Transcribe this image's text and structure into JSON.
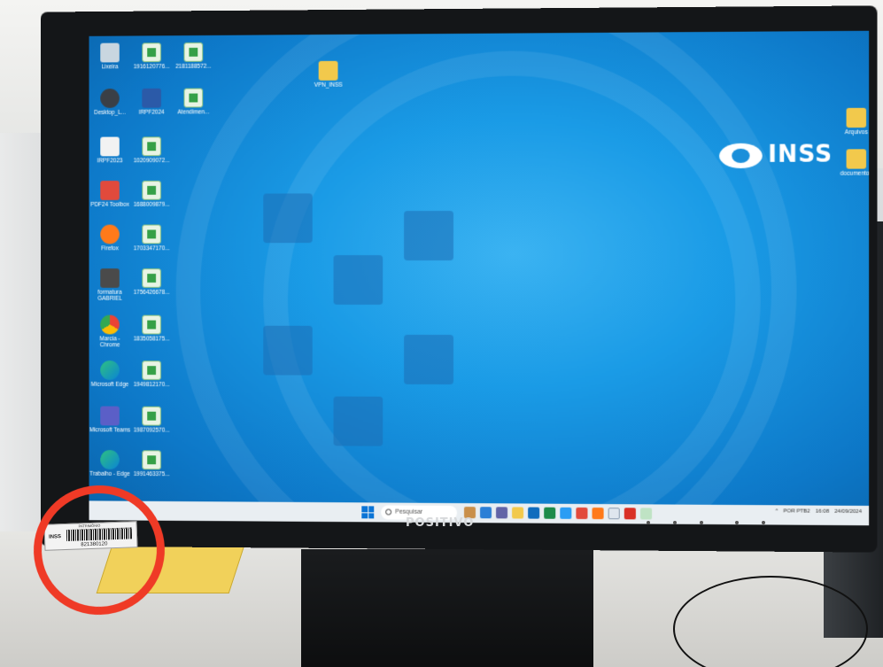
{
  "desktop": {
    "icons": [
      {
        "label": "Lixeira",
        "kind": "bin"
      },
      {
        "label": "1916120776...",
        "kind": "xls"
      },
      {
        "label": "2181188572...",
        "kind": "xls"
      },
      {
        "label": "Desktop_L...",
        "kind": "app"
      },
      {
        "label": "IRPF2024",
        "kind": "app"
      },
      {
        "label": "Atendimen...",
        "kind": "xls"
      },
      {
        "label": "IRPF2023",
        "kind": "app"
      },
      {
        "label": "1020909072...",
        "kind": "xls"
      },
      {
        "label": "PDF24 Toolbox",
        "kind": "app"
      },
      {
        "label": "1688009879...",
        "kind": "xls"
      },
      {
        "label": "Firefox",
        "kind": "app"
      },
      {
        "label": "1703347170...",
        "kind": "xls"
      },
      {
        "label": "formatura GABRIEL",
        "kind": "app"
      },
      {
        "label": "1756426678...",
        "kind": "xls"
      },
      {
        "label": "Marcia - Chrome",
        "kind": "app"
      },
      {
        "label": "1835058175...",
        "kind": "xls"
      },
      {
        "label": "Microsoft Edge",
        "kind": "app"
      },
      {
        "label": "1949812170...",
        "kind": "xls"
      },
      {
        "label": "Microsoft Teams",
        "kind": "app"
      },
      {
        "label": "1987092570...",
        "kind": "xls"
      },
      {
        "label": "Trabalho - Edge",
        "kind": "app"
      },
      {
        "label": "1991463375...",
        "kind": "xls"
      },
      {
        "label": "VPN_INSS",
        "kind": "folder"
      },
      {
        "label": "Arquivos",
        "kind": "folder"
      },
      {
        "label": "documentos",
        "kind": "folder"
      }
    ],
    "logo_text": "INSS"
  },
  "taskbar": {
    "search_placeholder": "Pesquisar",
    "tray_lang": "POR PTB2",
    "tray_time": "16:08",
    "tray_date": "24/09/2024"
  },
  "monitor": {
    "brand": "POSITIVO"
  },
  "sticker": {
    "heading": "PATRIMÔNIO",
    "org": "INSS",
    "number": "821380120"
  },
  "colors": {
    "wallpaper": "#1a9be6",
    "annotation_circle": "#ef3a26"
  }
}
